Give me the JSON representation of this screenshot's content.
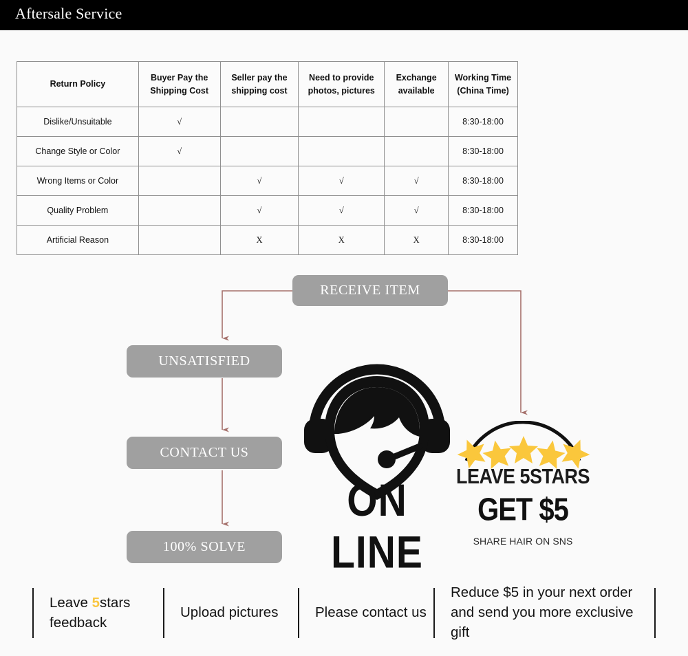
{
  "header": {
    "title": "Aftersale Service"
  },
  "table": {
    "columns": [
      {
        "id": "policy",
        "line1": "Return Policy",
        "line2": ""
      },
      {
        "id": "buyer",
        "line1": "Buyer Pay the",
        "line2": "Shipping Cost"
      },
      {
        "id": "seller",
        "line1": "Seller pay the",
        "line2": "shipping cost"
      },
      {
        "id": "photos",
        "line1": "Need to provide",
        "line2": "photos, pictures"
      },
      {
        "id": "exchange",
        "line1": "Exchange",
        "line2": "available"
      },
      {
        "id": "time",
        "line1": "Working Time",
        "line2": "(China Time)"
      }
    ],
    "rows": [
      {
        "policy": "Dislike/Unsuitable",
        "buyer": "√",
        "seller": "",
        "photos": "",
        "exchange": "",
        "time": "8:30-18:00"
      },
      {
        "policy": "Change Style or Color",
        "buyer": "√",
        "seller": "",
        "photos": "",
        "exchange": "",
        "time": "8:30-18:00"
      },
      {
        "policy": "Wrong Items or Color",
        "buyer": "",
        "seller": "√",
        "photos": "√",
        "exchange": "√",
        "time": "8:30-18:00"
      },
      {
        "policy": "Quality Problem",
        "buyer": "",
        "seller": "√",
        "photos": "√",
        "exchange": "√",
        "time": "8:30-18:00"
      },
      {
        "policy": "Artificial Reason",
        "buyer": "",
        "seller": "X",
        "photos": "X",
        "exchange": "X",
        "time": "8:30-18:00"
      }
    ]
  },
  "flow": {
    "receive_item": "RECEIVE ITEM",
    "unsatisfied": "UNSATISFIED",
    "contact_us": "CONTACT US",
    "solve": "100% SOLVE",
    "arrow_color": "#a5706b",
    "box_color": "#a0a0a0"
  },
  "online": {
    "label": "ON LINE",
    "icon": "headset-operator-icon"
  },
  "promo": {
    "leave_stars": "LEAVE 5STARS",
    "get": "GET $5",
    "share": "SHARE HAIR ON SNS",
    "star_count": 5,
    "star_color": "#fac73c"
  },
  "bottom": {
    "cell1_part1": "Leave ",
    "cell1_highlight": "5",
    "cell1_part2": "stars",
    "cell1_line2": "feedback",
    "cell2": "Upload pictures",
    "cell3": "Please contact us",
    "cell4_line1": "Reduce $5 in your next order",
    "cell4_line2": "and send you more exclusive gift",
    "highlight_color": "#f9c640"
  }
}
